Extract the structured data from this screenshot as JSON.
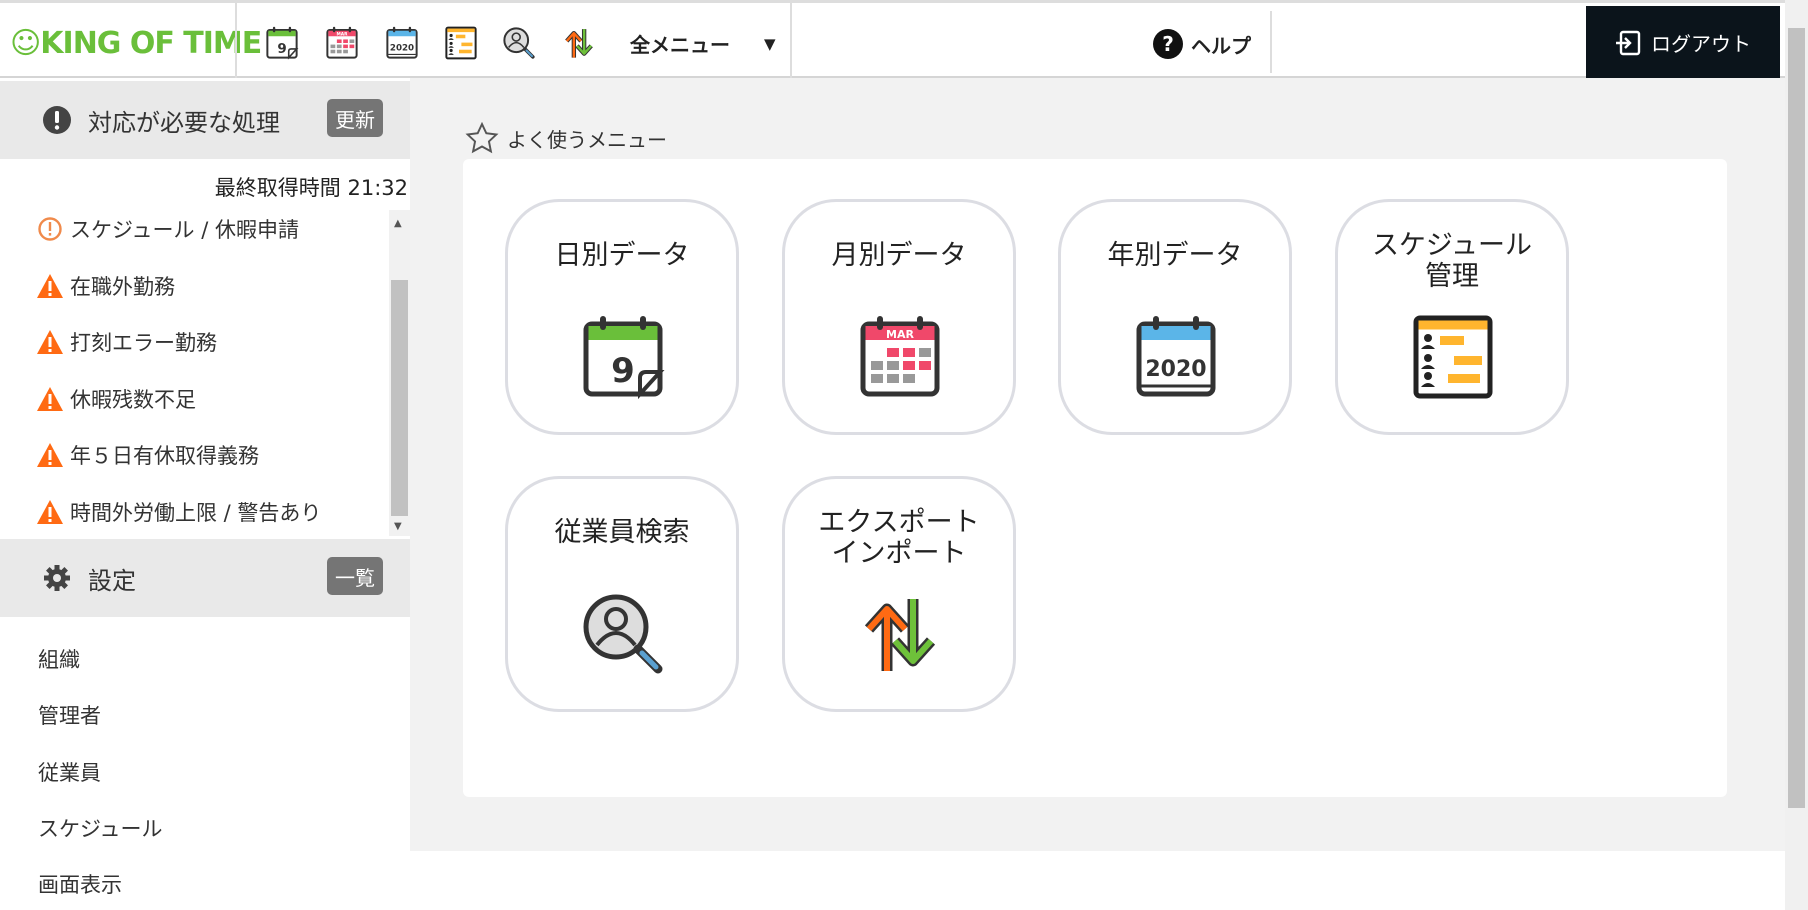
{
  "header": {
    "logo_text": "KING OF TIME",
    "quick_icons": [
      "daily-calendar-icon",
      "monthly-calendar-icon",
      "yearly-calendar-icon",
      "schedule-icon",
      "employee-search-icon",
      "export-import-icon"
    ],
    "all_menu_label": "全メニュー",
    "help_label": "ヘルプ",
    "logout_label": "ログアウト"
  },
  "sidebar": {
    "pending": {
      "title": "対応が必要な処理",
      "refresh_label": "更新",
      "last_fetched_label": "最終取得時間 21:32",
      "items": [
        {
          "label": "スケジュール / 休暇申請",
          "icon": "info-circle-icon"
        },
        {
          "label": "在職外勤務",
          "icon": "warning-icon"
        },
        {
          "label": "打刻エラー勤務",
          "icon": "warning-icon"
        },
        {
          "label": "休暇残数不足",
          "icon": "warning-icon"
        },
        {
          "label": "年５日有休取得義務",
          "icon": "warning-icon"
        },
        {
          "label": "時間外労働上限 / 警告あり",
          "icon": "warning-icon"
        }
      ]
    },
    "settings": {
      "title": "設定",
      "list_label": "一覧",
      "items": [
        "組織",
        "管理者",
        "従業員",
        "スケジュール",
        "画面表示"
      ]
    }
  },
  "main": {
    "favorites_title": "よく使うメニュー",
    "tiles": [
      {
        "line1": "日別データ",
        "line2": "",
        "icon": "daily"
      },
      {
        "line1": "月別データ",
        "line2": "",
        "icon": "monthly"
      },
      {
        "line1": "年別データ",
        "line2": "",
        "icon": "yearly"
      },
      {
        "line1": "スケジュール",
        "line2": "管理",
        "icon": "schedule"
      },
      {
        "line1": "従業員検索",
        "line2": "",
        "icon": "search"
      },
      {
        "line1": "エクスポート",
        "line2": "インポート",
        "icon": "exim"
      }
    ]
  },
  "colors": {
    "brand_green": "#6abf3a",
    "warning_orange": "#ff6a13",
    "logout_bg": "#0b141b",
    "monthly_red": "#f0486a",
    "yearly_blue": "#5bb5e8",
    "schedule_yellow": "#ffb52e"
  }
}
